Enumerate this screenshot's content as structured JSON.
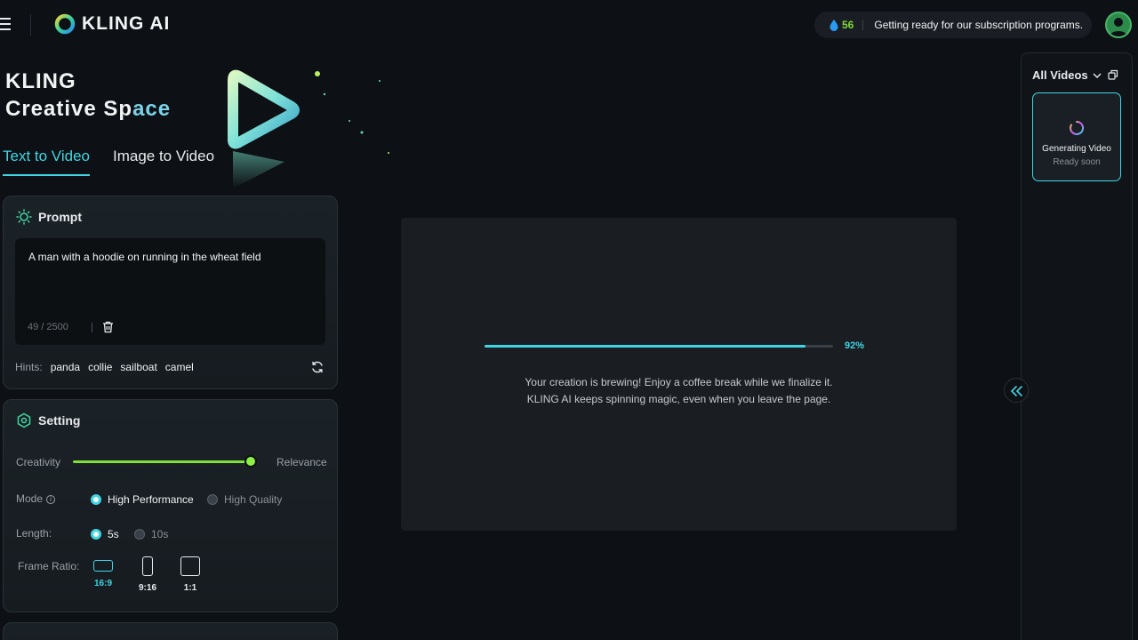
{
  "app": {
    "logo_text": "KLING AI"
  },
  "header": {
    "credits": "56",
    "notice": "Getting ready for our subscription programs."
  },
  "hero": {
    "line1": "KLING",
    "line2_a": "Creative Sp",
    "line2_b": "ace"
  },
  "tabs": [
    {
      "label": "Text to Video",
      "active": true
    },
    {
      "label": "Image to Video",
      "active": false
    }
  ],
  "prompt": {
    "title": "Prompt",
    "text": "A man with a hoodie on running in the wheat field",
    "counter": "49 / 2500",
    "hints_label": "Hints:",
    "hints": [
      "panda",
      "collie",
      "sailboat",
      "camel"
    ]
  },
  "setting": {
    "title": "Setting",
    "creativity_label": "Creativity",
    "relevance_label": "Relevance",
    "mode_label": "Mode",
    "mode_options": [
      "High Performance",
      "High Quality"
    ],
    "length_label": "Length:",
    "length_options": [
      "5s",
      "10s"
    ],
    "ratio_label": "Frame Ratio:",
    "ratios": [
      "16:9",
      "9:16",
      "1:1"
    ]
  },
  "generation": {
    "progress_percent": 92,
    "progress_label": "92%",
    "line1": "Your creation is brewing! Enjoy a coffee break while we finalize it.",
    "line2": "KLING AI keeps spinning magic, even when you leave the page."
  },
  "videos_panel": {
    "title": "All Videos",
    "card_title": "Generating Video",
    "card_sub": "Ready soon"
  },
  "colors": {
    "accent": "#3fd6e4",
    "lime": "#7fe03a"
  }
}
